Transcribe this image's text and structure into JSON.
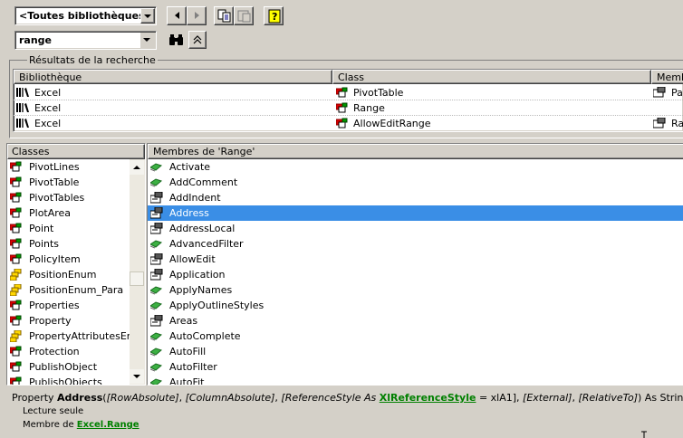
{
  "toolbar": {
    "library_combo_value": "<Toutes bibliothèques>",
    "search_combo_value": "range"
  },
  "results": {
    "group_label": "Résultats de la recherche",
    "columns": [
      "Bibliothèque",
      "Class",
      "Memb"
    ],
    "rows": [
      {
        "library": "Excel",
        "class": "PivotTable",
        "member": "Pa"
      },
      {
        "library": "Excel",
        "class": "Range",
        "member": ""
      },
      {
        "library": "Excel",
        "class": "AllowEditRange",
        "member": "Ra"
      }
    ]
  },
  "classes": {
    "header": "Classes",
    "items": [
      "PivotLines",
      "PivotTable",
      "PivotTables",
      "PlotArea",
      "Point",
      "Points",
      "PolicyItem",
      "PositionEnum",
      "PositionEnum_Para",
      "Properties",
      "Property",
      "PropertyAttributesEn",
      "Protection",
      "PublishObject",
      "PublishObjects"
    ]
  },
  "members": {
    "header": "Membres de 'Range'",
    "selected_index": 3,
    "items": [
      "Activate",
      "AddComment",
      "AddIndent",
      "Address",
      "AddressLocal",
      "AdvancedFilter",
      "AllowEdit",
      "Application",
      "ApplyNames",
      "ApplyOutlineStyles",
      "Areas",
      "AutoComplete",
      "AutoFill",
      "AutoFilter",
      "AutoFit"
    ]
  },
  "detail": {
    "prefix": "Property ",
    "name": "Address",
    "open": "(",
    "p1": "[RowAbsolute]",
    "sep1": ", ",
    "p2": "[ColumnAbsolute]",
    "sep2": ", ",
    "p3a": "[ReferenceStyle As ",
    "p3link": "XlReferenceStyle",
    "p3b": " = xlA1]",
    "sep3": ", ",
    "p4": "[External]",
    "sep4": ", ",
    "p5": "[RelativeTo]",
    "tail": ") As String",
    "readonly": "Lecture seule",
    "member_of": "Membre de ",
    "lib_link": "Excel",
    "dot": ".",
    "class_link": "Range"
  },
  "colors": {
    "selection": "#3a8ee6",
    "link": "#008000"
  }
}
